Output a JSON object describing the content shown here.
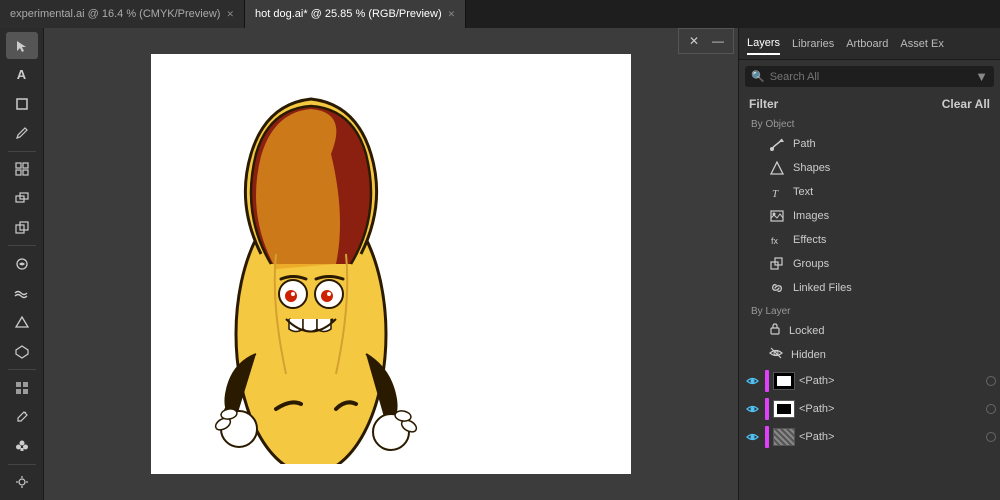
{
  "tabs": [
    {
      "id": "tab1",
      "label": "experimental.ai @ 16.4 % (CMYK/Preview)",
      "active": false
    },
    {
      "id": "tab2",
      "label": "hot dog.ai* @ 25.85 % (RGB/Preview)",
      "active": true
    }
  ],
  "panel": {
    "tabs": [
      "Layers",
      "Libraries",
      "Artboard",
      "Asset Ex"
    ],
    "active_tab": "Layers",
    "search_placeholder": "Search All",
    "filter_label": "Filter",
    "clear_all_label": "Clear All",
    "by_object_label": "By Object",
    "by_layer_label": "By Layer",
    "filter_items": [
      {
        "icon": "✒",
        "label": "Path"
      },
      {
        "icon": "◇",
        "label": "Shapes"
      },
      {
        "icon": "T",
        "label": "Text"
      },
      {
        "icon": "▦",
        "label": "Images"
      },
      {
        "icon": "fx",
        "label": "Effects"
      },
      {
        "icon": "⊞",
        "label": "Groups"
      },
      {
        "icon": "⊕",
        "label": "Linked Files"
      }
    ],
    "layer_items": [
      {
        "icon": "🔒",
        "label": "Locked"
      },
      {
        "icon": "👁",
        "label": "Hidden"
      }
    ],
    "paths": [
      {
        "name": "<Path>",
        "thumb": "black"
      },
      {
        "name": "<Path>",
        "thumb": "white"
      },
      {
        "name": "<Path>",
        "thumb": "striped"
      }
    ]
  },
  "tools": [
    "A",
    "▭",
    "✏",
    "⊕",
    "⟳",
    "✂",
    "☁",
    "⊟",
    "🖊",
    "⬡",
    "♣"
  ]
}
